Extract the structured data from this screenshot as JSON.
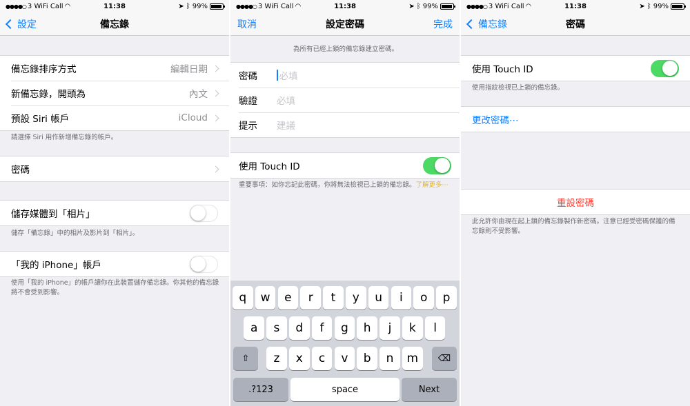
{
  "status": {
    "carrier": "3 WiFi Call",
    "time": "11:38",
    "battery": "99%"
  },
  "screen1": {
    "back_label": "設定",
    "title": "備忘錄",
    "group1": [
      {
        "label": "備忘錄排序方式",
        "value": "編輯日期"
      },
      {
        "label": "新備忘錄，開頭為",
        "value": "內文"
      },
      {
        "label": "預設 Siri 帳戶",
        "value": "iCloud"
      }
    ],
    "group1_footer": "請選擇 Siri 用作新增備忘錄的帳戶。",
    "password_label": "密碼",
    "save_media_label": "儲存媒體到「相片」",
    "save_media_footer": "儲存「備忘錄」中的相片及影片到「相片」。",
    "my_iphone_label": "「我的 iPhone」帳戶",
    "my_iphone_footer": "使用「我的 iPhone」的帳戶讓你在此裝置儲存備忘錄。你其他的備忘錄將不會受到影響。"
  },
  "screen2": {
    "cancel_label": "取消",
    "title": "設定密碼",
    "done_label": "完成",
    "header_text": "為所有已經上鎖的備忘錄建立密碼。",
    "fields": [
      {
        "label": "密碼",
        "placeholder": "必填"
      },
      {
        "label": "驗證",
        "placeholder": "必填"
      },
      {
        "label": "提示",
        "placeholder": "建議"
      }
    ],
    "touch_id_label": "使用 Touch ID",
    "footer_text": "重要事項：如你忘記此密碼，你將無法檢視已上鎖的備忘錄。",
    "learn_more": "了解更多⋯",
    "keyboard": {
      "row1": [
        "q",
        "w",
        "e",
        "r",
        "t",
        "y",
        "u",
        "i",
        "o",
        "p"
      ],
      "row2": [
        "a",
        "s",
        "d",
        "f",
        "g",
        "h",
        "j",
        "k",
        "l"
      ],
      "row3": [
        "z",
        "x",
        "c",
        "v",
        "b",
        "n",
        "m"
      ],
      "numbers_key": ".?123",
      "space_key": "space",
      "next_key": "Next"
    }
  },
  "screen3": {
    "back_label": "備忘錄",
    "title": "密碼",
    "touch_id_label": "使用 Touch ID",
    "touch_id_footer": "使用指紋檢視已上鎖的備忘錄。",
    "change_password": "更改密碼⋯",
    "reset_password": "重設密碼",
    "reset_footer": "此允許你由現在起上鎖的備忘錄製作新密碼。注意已經受密碼保護的備忘錄則不受影響。"
  },
  "colors": {
    "accent": "#147efb",
    "toggle_on": "#4cd964",
    "destructive": "#ff3b30",
    "link": "#e6b422"
  }
}
